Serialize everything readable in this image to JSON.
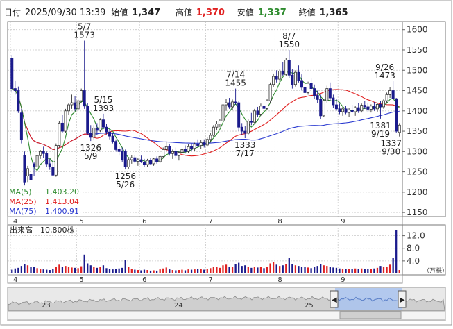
{
  "header": {
    "date_label": "日付",
    "date_value": "2025/09/30 13:39",
    "open_label": "始値",
    "open_value": "1,347",
    "high_label": "高値",
    "high_value": "1,370",
    "low_label": "安値",
    "low_value": "1,337",
    "close_label": "終値",
    "close_value": "1,365"
  },
  "legend": [
    {
      "label": "MA(5)",
      "value": "1,403.20",
      "color": "#2e8b2e"
    },
    {
      "label": "MA(25)",
      "value": "1,413.04",
      "color": "#e02020"
    },
    {
      "label": "MA(75)",
      "value": "1,400.91",
      "color": "#2a3ad0"
    }
  ],
  "volume_label": "出来高　10,800株",
  "volume_unit": "（万株）",
  "navigator": {
    "year_labels": [
      "23",
      "24",
      "25"
    ]
  },
  "colors": {
    "up": "#e02020",
    "down": "#1a1a8c",
    "ma5": "#2e8b2e",
    "ma25": "#e02020",
    "ma75": "#2a3ad0",
    "grid": "#c8c8c8",
    "navigator_fill": "#a9c3ef"
  },
  "chart_data": {
    "type": "candlestick",
    "price_axis": {
      "ticks": [
        1600,
        1550,
        1500,
        1450,
        1400,
        1350,
        1300,
        1250,
        1200,
        1150
      ],
      "ylim": [
        1140,
        1620
      ]
    },
    "volume_axis": {
      "ticks": [
        12.0,
        8.0,
        4.0
      ],
      "ylim": [
        0,
        15
      ]
    },
    "month_labels": [
      "4",
      "5",
      "6",
      "7",
      "8",
      "9"
    ],
    "annotations": [
      {
        "value": "1573",
        "date": "5/7"
      },
      {
        "value": "1393",
        "date": "5/15"
      },
      {
        "value": "1326",
        "date": "5/9"
      },
      {
        "value": "1256",
        "date": "5/26"
      },
      {
        "value": "1455",
        "date": "7/14"
      },
      {
        "value": "1333",
        "date": "7/17"
      },
      {
        "value": "1550",
        "date": "8/7"
      },
      {
        "value": "1473",
        "date": "9/26"
      },
      {
        "value": "1381",
        "date": "9/19"
      },
      {
        "value": "1337",
        "date": "9/30"
      }
    ],
    "candles": [
      {
        "d": "04-01",
        "o": 1530,
        "h": 1538,
        "l": 1445,
        "c": 1455,
        "v": 1.2
      },
      {
        "d": "04-02",
        "o": 1455,
        "h": 1475,
        "l": 1440,
        "c": 1450,
        "v": 1.6
      },
      {
        "d": "04-03",
        "o": 1450,
        "h": 1460,
        "l": 1395,
        "c": 1400,
        "v": 1.8
      },
      {
        "d": "04-04",
        "o": 1395,
        "h": 1405,
        "l": 1320,
        "c": 1330,
        "v": 2.4
      },
      {
        "d": "04-07",
        "o": 1290,
        "h": 1300,
        "l": 1215,
        "c": 1225,
        "v": 3.0
      },
      {
        "d": "04-08",
        "o": 1240,
        "h": 1265,
        "l": 1225,
        "c": 1258,
        "v": 2.6
      },
      {
        "d": "04-09",
        "o": 1245,
        "h": 1258,
        "l": 1210,
        "c": 1230,
        "v": 2.0
      },
      {
        "d": "04-10",
        "o": 1270,
        "h": 1275,
        "l": 1240,
        "c": 1262,
        "v": 2.1
      },
      {
        "d": "04-11",
        "o": 1262,
        "h": 1292,
        "l": 1255,
        "c": 1290,
        "v": 1.7
      },
      {
        "d": "04-14",
        "o": 1290,
        "h": 1304,
        "l": 1282,
        "c": 1300,
        "v": 1.5
      },
      {
        "d": "04-15",
        "o": 1300,
        "h": 1312,
        "l": 1285,
        "c": 1295,
        "v": 1.3
      },
      {
        "d": "04-16",
        "o": 1295,
        "h": 1300,
        "l": 1262,
        "c": 1270,
        "v": 1.2
      },
      {
        "d": "04-17",
        "o": 1270,
        "h": 1282,
        "l": 1255,
        "c": 1262,
        "v": 1.1
      },
      {
        "d": "04-18",
        "o": 1262,
        "h": 1280,
        "l": 1240,
        "c": 1242,
        "v": 1.4
      },
      {
        "d": "04-21",
        "o": 1242,
        "h": 1320,
        "l": 1238,
        "c": 1315,
        "v": 2.2
      },
      {
        "d": "04-22",
        "o": 1315,
        "h": 1375,
        "l": 1310,
        "c": 1370,
        "v": 2.8
      },
      {
        "d": "04-23",
        "o": 1370,
        "h": 1390,
        "l": 1345,
        "c": 1350,
        "v": 2.0
      },
      {
        "d": "04-24",
        "o": 1350,
        "h": 1405,
        "l": 1345,
        "c": 1400,
        "v": 2.4
      },
      {
        "d": "04-25",
        "o": 1400,
        "h": 1420,
        "l": 1390,
        "c": 1415,
        "v": 2.0
      },
      {
        "d": "04-28",
        "o": 1415,
        "h": 1440,
        "l": 1405,
        "c": 1420,
        "v": 1.9
      },
      {
        "d": "04-30",
        "o": 1420,
        "h": 1436,
        "l": 1400,
        "c": 1405,
        "v": 1.8
      },
      {
        "d": "05-01",
        "o": 1405,
        "h": 1430,
        "l": 1400,
        "c": 1425,
        "v": 1.7
      },
      {
        "d": "05-02",
        "o": 1425,
        "h": 1455,
        "l": 1420,
        "c": 1450,
        "v": 2.3
      },
      {
        "d": "05-07",
        "o": 1450,
        "h": 1573,
        "l": 1405,
        "c": 1412,
        "v": 6.0
      },
      {
        "d": "05-08",
        "o": 1412,
        "h": 1420,
        "l": 1340,
        "c": 1345,
        "v": 3.2
      },
      {
        "d": "05-09",
        "o": 1345,
        "h": 1365,
        "l": 1326,
        "c": 1335,
        "v": 2.6
      },
      {
        "d": "05-12",
        "o": 1335,
        "h": 1365,
        "l": 1330,
        "c": 1358,
        "v": 2.0
      },
      {
        "d": "05-13",
        "o": 1358,
        "h": 1370,
        "l": 1340,
        "c": 1352,
        "v": 1.8
      },
      {
        "d": "05-14",
        "o": 1352,
        "h": 1382,
        "l": 1348,
        "c": 1378,
        "v": 2.0
      },
      {
        "d": "05-15",
        "o": 1378,
        "h": 1393,
        "l": 1355,
        "c": 1360,
        "v": 2.6
      },
      {
        "d": "05-16",
        "o": 1360,
        "h": 1368,
        "l": 1342,
        "c": 1348,
        "v": 1.7
      },
      {
        "d": "05-19",
        "o": 1348,
        "h": 1355,
        "l": 1330,
        "c": 1338,
        "v": 1.4
      },
      {
        "d": "05-20",
        "o": 1338,
        "h": 1345,
        "l": 1320,
        "c": 1325,
        "v": 1.3
      },
      {
        "d": "05-21",
        "o": 1325,
        "h": 1330,
        "l": 1300,
        "c": 1305,
        "v": 1.5
      },
      {
        "d": "05-22",
        "o": 1305,
        "h": 1315,
        "l": 1290,
        "c": 1300,
        "v": 1.6
      },
      {
        "d": "05-23",
        "o": 1300,
        "h": 1310,
        "l": 1275,
        "c": 1280,
        "v": 1.8
      },
      {
        "d": "05-26",
        "o": 1300,
        "h": 1305,
        "l": 1256,
        "c": 1262,
        "v": 4.2
      },
      {
        "d": "05-27",
        "o": 1262,
        "h": 1285,
        "l": 1258,
        "c": 1280,
        "v": 2.0
      },
      {
        "d": "05-28",
        "o": 1280,
        "h": 1292,
        "l": 1270,
        "c": 1285,
        "v": 1.5
      },
      {
        "d": "05-29",
        "o": 1285,
        "h": 1292,
        "l": 1272,
        "c": 1276,
        "v": 1.2
      },
      {
        "d": "05-30",
        "o": 1276,
        "h": 1284,
        "l": 1265,
        "c": 1280,
        "v": 1.1
      },
      {
        "d": "06-02",
        "o": 1280,
        "h": 1290,
        "l": 1272,
        "c": 1274,
        "v": 1.0
      },
      {
        "d": "06-03",
        "o": 1274,
        "h": 1282,
        "l": 1262,
        "c": 1268,
        "v": 1.2
      },
      {
        "d": "06-04",
        "o": 1268,
        "h": 1282,
        "l": 1262,
        "c": 1278,
        "v": 1.1
      },
      {
        "d": "06-05",
        "o": 1278,
        "h": 1284,
        "l": 1268,
        "c": 1270,
        "v": 0.9
      },
      {
        "d": "06-06",
        "o": 1270,
        "h": 1285,
        "l": 1265,
        "c": 1282,
        "v": 1.0
      },
      {
        "d": "06-09",
        "o": 1282,
        "h": 1288,
        "l": 1270,
        "c": 1275,
        "v": 0.9
      },
      {
        "d": "06-10",
        "o": 1275,
        "h": 1290,
        "l": 1272,
        "c": 1288,
        "v": 1.3
      },
      {
        "d": "06-11",
        "o": 1288,
        "h": 1310,
        "l": 1285,
        "c": 1305,
        "v": 1.6
      },
      {
        "d": "06-12",
        "o": 1305,
        "h": 1325,
        "l": 1300,
        "c": 1312,
        "v": 1.9
      },
      {
        "d": "06-13",
        "o": 1312,
        "h": 1318,
        "l": 1290,
        "c": 1295,
        "v": 1.3
      },
      {
        "d": "06-16",
        "o": 1295,
        "h": 1305,
        "l": 1282,
        "c": 1300,
        "v": 1.1
      },
      {
        "d": "06-17",
        "o": 1300,
        "h": 1310,
        "l": 1285,
        "c": 1290,
        "v": 1.0
      },
      {
        "d": "06-18",
        "o": 1290,
        "h": 1302,
        "l": 1278,
        "c": 1298,
        "v": 1.1
      },
      {
        "d": "06-19",
        "o": 1298,
        "h": 1310,
        "l": 1292,
        "c": 1305,
        "v": 1.2
      },
      {
        "d": "06-20",
        "o": 1305,
        "h": 1315,
        "l": 1295,
        "c": 1300,
        "v": 1.0
      },
      {
        "d": "06-23",
        "o": 1300,
        "h": 1318,
        "l": 1296,
        "c": 1312,
        "v": 1.3
      },
      {
        "d": "06-24",
        "o": 1312,
        "h": 1320,
        "l": 1302,
        "c": 1308,
        "v": 1.2
      },
      {
        "d": "06-25",
        "o": 1308,
        "h": 1322,
        "l": 1302,
        "c": 1318,
        "v": 1.3
      },
      {
        "d": "06-26",
        "o": 1318,
        "h": 1330,
        "l": 1310,
        "c": 1315,
        "v": 1.4
      },
      {
        "d": "06-27",
        "o": 1315,
        "h": 1328,
        "l": 1306,
        "c": 1322,
        "v": 1.4
      },
      {
        "d": "06-30",
        "o": 1322,
        "h": 1330,
        "l": 1310,
        "c": 1316,
        "v": 1.2
      },
      {
        "d": "07-01",
        "o": 1316,
        "h": 1335,
        "l": 1312,
        "c": 1330,
        "v": 1.5
      },
      {
        "d": "07-02",
        "o": 1330,
        "h": 1345,
        "l": 1322,
        "c": 1340,
        "v": 1.7
      },
      {
        "d": "07-03",
        "o": 1340,
        "h": 1365,
        "l": 1335,
        "c": 1360,
        "v": 2.0
      },
      {
        "d": "07-04",
        "o": 1360,
        "h": 1375,
        "l": 1352,
        "c": 1368,
        "v": 2.1
      },
      {
        "d": "07-07",
        "o": 1368,
        "h": 1380,
        "l": 1360,
        "c": 1375,
        "v": 1.8
      },
      {
        "d": "07-08",
        "o": 1375,
        "h": 1420,
        "l": 1370,
        "c": 1415,
        "v": 2.6
      },
      {
        "d": "07-09",
        "o": 1415,
        "h": 1430,
        "l": 1400,
        "c": 1420,
        "v": 2.8
      },
      {
        "d": "07-10",
        "o": 1420,
        "h": 1432,
        "l": 1405,
        "c": 1410,
        "v": 2.2
      },
      {
        "d": "07-11",
        "o": 1410,
        "h": 1428,
        "l": 1402,
        "c": 1422,
        "v": 2.0
      },
      {
        "d": "07-14",
        "o": 1422,
        "h": 1455,
        "l": 1415,
        "c": 1420,
        "v": 3.0
      },
      {
        "d": "07-15",
        "o": 1420,
        "h": 1425,
        "l": 1350,
        "c": 1360,
        "v": 3.4
      },
      {
        "d": "07-16",
        "o": 1360,
        "h": 1370,
        "l": 1340,
        "c": 1350,
        "v": 2.4
      },
      {
        "d": "07-17",
        "o": 1350,
        "h": 1362,
        "l": 1333,
        "c": 1345,
        "v": 2.6
      },
      {
        "d": "07-18",
        "o": 1345,
        "h": 1380,
        "l": 1340,
        "c": 1375,
        "v": 2.2
      },
      {
        "d": "07-22",
        "o": 1375,
        "h": 1395,
        "l": 1365,
        "c": 1372,
        "v": 1.8
      },
      {
        "d": "07-23",
        "o": 1372,
        "h": 1405,
        "l": 1368,
        "c": 1400,
        "v": 2.2
      },
      {
        "d": "07-24",
        "o": 1400,
        "h": 1410,
        "l": 1385,
        "c": 1392,
        "v": 1.9
      },
      {
        "d": "07-25",
        "o": 1392,
        "h": 1418,
        "l": 1388,
        "c": 1412,
        "v": 2.0
      },
      {
        "d": "07-28",
        "o": 1412,
        "h": 1425,
        "l": 1400,
        "c": 1406,
        "v": 1.7
      },
      {
        "d": "07-29",
        "o": 1406,
        "h": 1430,
        "l": 1402,
        "c": 1425,
        "v": 2.0
      },
      {
        "d": "07-30",
        "o": 1425,
        "h": 1470,
        "l": 1420,
        "c": 1465,
        "v": 3.2
      },
      {
        "d": "07-31",
        "o": 1465,
        "h": 1492,
        "l": 1458,
        "c": 1485,
        "v": 3.6
      },
      {
        "d": "08-01",
        "o": 1485,
        "h": 1500,
        "l": 1470,
        "c": 1478,
        "v": 2.8
      },
      {
        "d": "08-04",
        "o": 1478,
        "h": 1502,
        "l": 1470,
        "c": 1498,
        "v": 2.4
      },
      {
        "d": "08-05",
        "o": 1498,
        "h": 1520,
        "l": 1485,
        "c": 1490,
        "v": 2.6
      },
      {
        "d": "08-06",
        "o": 1490,
        "h": 1530,
        "l": 1486,
        "c": 1525,
        "v": 3.0
      },
      {
        "d": "08-07",
        "o": 1525,
        "h": 1550,
        "l": 1480,
        "c": 1488,
        "v": 5.0
      },
      {
        "d": "08-08",
        "o": 1488,
        "h": 1502,
        "l": 1455,
        "c": 1465,
        "v": 3.0
      },
      {
        "d": "08-12",
        "o": 1465,
        "h": 1500,
        "l": 1460,
        "c": 1495,
        "v": 2.6
      },
      {
        "d": "08-13",
        "o": 1495,
        "h": 1512,
        "l": 1470,
        "c": 1475,
        "v": 2.4
      },
      {
        "d": "08-14",
        "o": 1475,
        "h": 1490,
        "l": 1450,
        "c": 1458,
        "v": 2.2
      },
      {
        "d": "08-15",
        "o": 1458,
        "h": 1470,
        "l": 1440,
        "c": 1445,
        "v": 2.0
      },
      {
        "d": "08-18",
        "o": 1445,
        "h": 1472,
        "l": 1440,
        "c": 1468,
        "v": 1.9
      },
      {
        "d": "08-19",
        "o": 1468,
        "h": 1480,
        "l": 1450,
        "c": 1455,
        "v": 1.7
      },
      {
        "d": "08-20",
        "o": 1455,
        "h": 1465,
        "l": 1430,
        "c": 1438,
        "v": 2.0
      },
      {
        "d": "08-21",
        "o": 1438,
        "h": 1450,
        "l": 1420,
        "c": 1428,
        "v": 2.4
      },
      {
        "d": "08-22",
        "o": 1428,
        "h": 1440,
        "l": 1380,
        "c": 1388,
        "v": 3.0
      },
      {
        "d": "08-25",
        "o": 1388,
        "h": 1430,
        "l": 1385,
        "c": 1425,
        "v": 2.6
      },
      {
        "d": "08-26",
        "o": 1425,
        "h": 1462,
        "l": 1420,
        "c": 1455,
        "v": 2.4
      },
      {
        "d": "08-27",
        "o": 1455,
        "h": 1470,
        "l": 1425,
        "c": 1432,
        "v": 2.0
      },
      {
        "d": "08-28",
        "o": 1432,
        "h": 1440,
        "l": 1408,
        "c": 1415,
        "v": 1.9
      },
      {
        "d": "08-29",
        "o": 1415,
        "h": 1430,
        "l": 1400,
        "c": 1405,
        "v": 1.8
      },
      {
        "d": "09-01",
        "o": 1405,
        "h": 1418,
        "l": 1392,
        "c": 1398,
        "v": 1.6
      },
      {
        "d": "09-02",
        "o": 1398,
        "h": 1410,
        "l": 1388,
        "c": 1405,
        "v": 1.5
      },
      {
        "d": "09-03",
        "o": 1405,
        "h": 1412,
        "l": 1392,
        "c": 1396,
        "v": 1.4
      },
      {
        "d": "09-04",
        "o": 1396,
        "h": 1408,
        "l": 1385,
        "c": 1402,
        "v": 1.5
      },
      {
        "d": "09-05",
        "o": 1402,
        "h": 1415,
        "l": 1395,
        "c": 1398,
        "v": 1.4
      },
      {
        "d": "09-08",
        "o": 1398,
        "h": 1412,
        "l": 1388,
        "c": 1408,
        "v": 1.6
      },
      {
        "d": "09-09",
        "o": 1408,
        "h": 1420,
        "l": 1395,
        "c": 1400,
        "v": 1.5
      },
      {
        "d": "09-10",
        "o": 1400,
        "h": 1418,
        "l": 1396,
        "c": 1414,
        "v": 1.6
      },
      {
        "d": "09-11",
        "o": 1414,
        "h": 1425,
        "l": 1405,
        "c": 1410,
        "v": 1.5
      },
      {
        "d": "09-12",
        "o": 1410,
        "h": 1420,
        "l": 1398,
        "c": 1404,
        "v": 1.4
      },
      {
        "d": "09-16",
        "o": 1404,
        "h": 1416,
        "l": 1396,
        "c": 1412,
        "v": 1.5
      },
      {
        "d": "09-17",
        "o": 1412,
        "h": 1422,
        "l": 1400,
        "c": 1405,
        "v": 1.6
      },
      {
        "d": "09-18",
        "o": 1405,
        "h": 1420,
        "l": 1398,
        "c": 1416,
        "v": 1.8
      },
      {
        "d": "09-19",
        "o": 1416,
        "h": 1425,
        "l": 1381,
        "c": 1410,
        "v": 2.4
      },
      {
        "d": "09-22",
        "o": 1410,
        "h": 1430,
        "l": 1405,
        "c": 1425,
        "v": 2.0
      },
      {
        "d": "09-24",
        "o": 1425,
        "h": 1445,
        "l": 1420,
        "c": 1440,
        "v": 2.2
      },
      {
        "d": "09-25",
        "o": 1440,
        "h": 1458,
        "l": 1432,
        "c": 1450,
        "v": 2.8
      },
      {
        "d": "09-26",
        "o": 1450,
        "h": 1473,
        "l": 1425,
        "c": 1430,
        "v": 5.0
      },
      {
        "d": "09-29",
        "o": 1430,
        "h": 1432,
        "l": 1345,
        "c": 1350,
        "v": 13.8
      },
      {
        "d": "09-30",
        "o": 1347,
        "h": 1370,
        "l": 1337,
        "c": 1365,
        "v": 1.1
      }
    ]
  }
}
